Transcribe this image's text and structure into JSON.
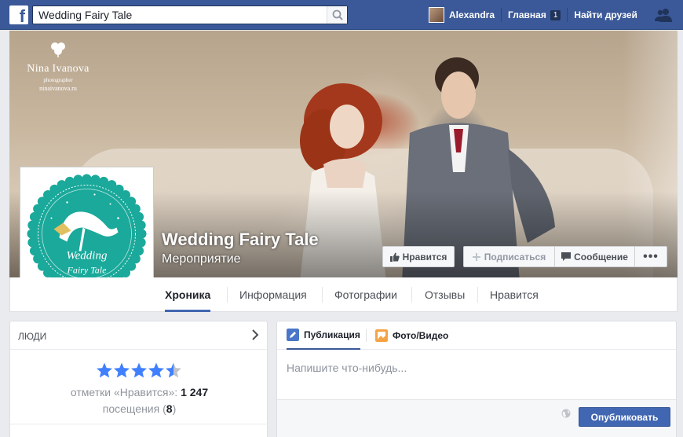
{
  "topbar": {
    "search_value": "Wedding Fairy Tale",
    "user_name": "Alexandra",
    "home_label": "Главная",
    "home_count": "1",
    "find_friends_label": "Найти друзей"
  },
  "cover": {
    "photographer_name": "Nina Ivanova",
    "photographer_sub": "photographer",
    "photographer_site": "ninaivanova.ru"
  },
  "page": {
    "name": "Wedding Fairy Tale",
    "category": "Мероприятие",
    "logo_line1": "Wedding",
    "logo_line2": "Fairy Tale"
  },
  "actions": {
    "like": "Нравится",
    "subscribe": "Подписаться",
    "message": "Сообщение",
    "more": "•••"
  },
  "tabs": [
    "Хроника",
    "Информация",
    "Фотографии",
    "Отзывы",
    "Нравится"
  ],
  "people": {
    "title": "ЛЮДИ",
    "rating": 4.5,
    "likes_label": "отметки «Нравится»: ",
    "likes_count": "1 247",
    "visits_label": "посещения (",
    "visits_count": "8",
    "visits_close": ")"
  },
  "composer": {
    "tab_post": "Публикация",
    "tab_photo": "Фото/Видео",
    "placeholder": "Напишите что-нибудь...",
    "publish": "Опубликовать"
  },
  "colors": {
    "facebook_blue": "#3b5998",
    "button_blue": "#4267b2",
    "logo_teal": "#1aa99a",
    "star_blue": "#4080ff"
  }
}
